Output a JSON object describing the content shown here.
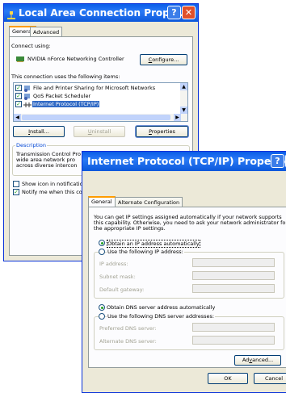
{
  "lac": {
    "title": "Local Area Connection Prope...",
    "tabs": [
      "General",
      "Advanced"
    ],
    "connect_using_label": "Connect using:",
    "adapter_name": "NVIDIA nForce Networking Controller",
    "configure_button": "Configure...",
    "items_label": "This connection uses the following items:",
    "items": [
      {
        "label": "File and Printer Sharing for Microsoft Networks",
        "checked": true,
        "selected": false
      },
      {
        "label": "QoS Packet Scheduler",
        "checked": true,
        "selected": false
      },
      {
        "label": "Internet Protocol (TCP/IP)",
        "checked": true,
        "selected": true
      }
    ],
    "install_button": "Install...",
    "uninstall_button": "Uninstall",
    "properties_button": "Properties",
    "description_label": "Description",
    "description_lines": [
      "Transmission Control Pro",
      "wide area network pro",
      "across diverse intercon"
    ],
    "show_icon_label": "Show icon in notificatio",
    "notify_label": "Notify me when this co"
  },
  "tcpip": {
    "title": "Internet Protocol (TCP/IP) Properties",
    "tabs": [
      "General",
      "Alternate Configuration"
    ],
    "intro_lines": [
      "You can get IP settings assigned automatically if your network supports",
      "this capability. Otherwise, you need to ask your network administrator for",
      "the appropriate IP settings."
    ],
    "obtain_ip_label": "Obtain an IP address automatically",
    "use_ip_label": "Use the following IP address:",
    "ip_address_label": "IP address:",
    "subnet_label": "Subnet mask:",
    "gateway_label": "Default gateway:",
    "obtain_dns_label": "Obtain DNS server address automatically",
    "use_dns_label": "Use the following DNS server addresses:",
    "preferred_dns_label": "Preferred DNS server:",
    "alternate_dns_label": "Alternate DNS server:",
    "advanced_button": "Advanced...",
    "ok_button": "OK",
    "cancel_button": "Cancel"
  }
}
